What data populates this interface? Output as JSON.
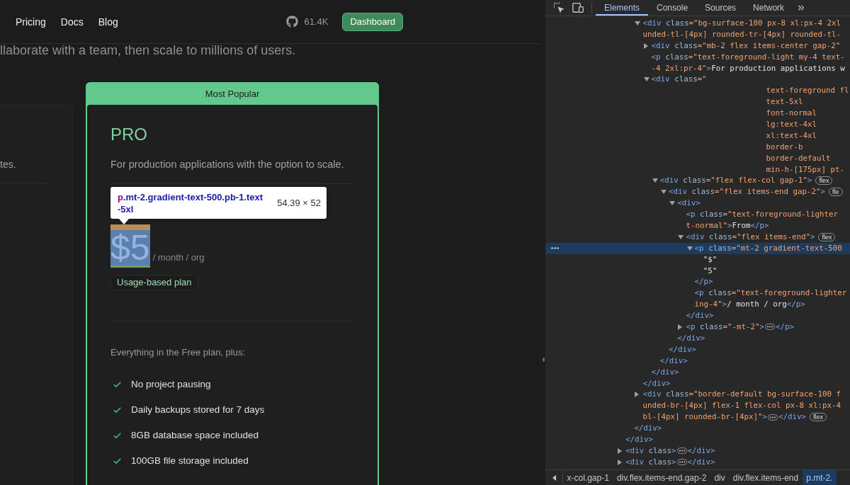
{
  "page": {
    "nav": {
      "links": [
        "Pricing",
        "Docs",
        "Blog"
      ],
      "github_stars": "61.4K",
      "dashboard_button": "Dashboard"
    },
    "subtitle": "llaborate with a team, then scale to millions of users.",
    "side_card": {
      "description": "tes."
    },
    "pro_card": {
      "ribbon": "Most Popular",
      "name": "PRO",
      "description": "For production applications with the option to scale.",
      "price": "$5",
      "price_highlighted": true,
      "period": "/ month / org",
      "badge": "Usage-based plan",
      "features_intro": "Everything in the Free plan, plus:",
      "features": [
        "No project pausing",
        "Daily backups stored for 7 days",
        "8GB database space included",
        "100GB file storage included"
      ]
    },
    "inspect_tooltip": {
      "tag": "p",
      "selector": ".mt-2.gradient-text-500.pb-1.text-5xl",
      "size": "54.39 × 52"
    }
  },
  "devtools": {
    "tabs": [
      {
        "label": "Elements",
        "selected": true
      },
      {
        "label": "Console",
        "selected": false
      },
      {
        "label": "Sources",
        "selected": false
      },
      {
        "label": "Network",
        "selected": false
      }
    ],
    "dom_tree": [
      {
        "selected": false,
        "children": [
          {
            "selected": false,
            "children": [
              {
                "expanded": true,
                "selected": false,
                "lines": [
                  [
                    {
                      "kind": "tag",
                      "text": "<div"
                    },
                    {
                      "kind": "attr",
                      "text": "class"
                    },
                    {
                      "kind": "value",
                      "text": "=\"bg-surface-100 px-8 xl:px-4 2xl"
                    }
                  ],
                  [
                    {
                      "kind": "value",
                      "text": "unded-tl-[4px] rounded-tr-[4px] rounded-tl-"
                    }
                  ]
                ],
                "children": [
                  {
                    "expanded": false,
                    "selected": false,
                    "lines": [
                      [
                        {
                          "kind": "tag",
                          "text": "<div"
                        },
                        {
                          "kind": "attr",
                          "text": "class"
                        },
                        {
                          "kind": "value",
                          "text": "=\"mb-2 flex items-center gap-2\""
                        }
                      ]
                    ]
                  },
                  {
                    "selected": false,
                    "lines": [
                      [
                        {
                          "kind": "tag",
                          "text": "<p"
                        },
                        {
                          "kind": "attr",
                          "text": "class"
                        },
                        {
                          "kind": "value",
                          "text": "=\"text-foreground-light my-4 text-"
                        }
                      ],
                      [
                        {
                          "kind": "value",
                          "text": "-4 2xl:pr-4\""
                        },
                        {
                          "kind": "tag",
                          "text": ">"
                        },
                        {
                          "kind": "text",
                          "text": "For production applications w"
                        }
                      ]
                    ]
                  },
                  {
                    "expanded": true,
                    "selected": false,
                    "lines": [
                      [
                        {
                          "kind": "tag",
                          "text": "<div"
                        },
                        {
                          "kind": "attr",
                          "text": "class"
                        },
                        {
                          "kind": "value",
                          "text": "=\""
                        }
                      ]
                    ],
                    "class_lines": [
                      "text-foreground fl",
                      "text-5xl",
                      "font-normal",
                      "lg:text-4xl",
                      "xl:text-4xl",
                      "border-b",
                      "border-default",
                      "min-h-[175px] pt-"
                    ],
                    "children": [
                      {
                        "expanded": true,
                        "selected": false,
                        "lines": [
                          [
                            {
                              "kind": "tag",
                              "text": "<div"
                            },
                            {
                              "kind": "attr",
                              "text": "class"
                            },
                            {
                              "kind": "value",
                              "text": "=\"flex flex-col gap-1\""
                            },
                            {
                              "kind": "tag",
                              "text": ">"
                            },
                            {
                              "kind": "badge",
                              "text": "flex"
                            }
                          ]
                        ],
                        "children": [
                          {
                            "expanded": true,
                            "selected": false,
                            "lines": [
                              [
                                {
                                  "kind": "tag",
                                  "text": "<div"
                                },
                                {
                                  "kind": "attr",
                                  "text": "class"
                                },
                                {
                                  "kind": "value",
                                  "text": "=\"flex items-end gap-2\""
                                },
                                {
                                  "kind": "tag",
                                  "text": ">"
                                },
                                {
                                  "kind": "badge",
                                  "text": "fle"
                                }
                              ]
                            ],
                            "children": [
                              {
                                "expanded": true,
                                "selected": false,
                                "lines": [
                                  [
                                    {
                                      "kind": "tag",
                                      "text": "<div>"
                                    }
                                  ]
                                ],
                                "children": [
                                  {
                                    "selected": false,
                                    "lines": [
                                      [
                                        {
                                          "kind": "tag",
                                          "text": "<p"
                                        },
                                        {
                                          "kind": "attr",
                                          "text": "class"
                                        },
                                        {
                                          "kind": "value",
                                          "text": "=\"text-foreground-lighter"
                                        }
                                      ],
                                      [
                                        {
                                          "kind": "value",
                                          "text": "t-normal\""
                                        },
                                        {
                                          "kind": "tag",
                                          "text": ">"
                                        },
                                        {
                                          "kind": "text",
                                          "text": "From"
                                        },
                                        {
                                          "kind": "tag",
                                          "text": "</p>"
                                        }
                                      ]
                                    ]
                                  },
                                  {
                                    "expanded": true,
                                    "selected": false,
                                    "lines": [
                                      [
                                        {
                                          "kind": "tag",
                                          "text": "<div"
                                        },
                                        {
                                          "kind": "attr",
                                          "text": "class"
                                        },
                                        {
                                          "kind": "value",
                                          "text": "=\"flex items-end\""
                                        },
                                        {
                                          "kind": "tag",
                                          "text": ">"
                                        },
                                        {
                                          "kind": "badge",
                                          "text": "flex"
                                        }
                                      ]
                                    ],
                                    "children": [
                                      {
                                        "expanded": true,
                                        "selected": true,
                                        "lines": [
                                          [
                                            {
                                              "kind": "tag",
                                              "text": "<p"
                                            },
                                            {
                                              "kind": "attr",
                                              "text": "class"
                                            },
                                            {
                                              "kind": "value",
                                              "text": "=\"mt-2 gradient-text-500"
                                            }
                                          ]
                                        ],
                                        "children": [
                                          {
                                            "selected": false,
                                            "lines": [
                                              [
                                                {
                                                  "kind": "text",
                                                  "text": "\"$\""
                                                }
                                              ]
                                            ]
                                          },
                                          {
                                            "selected": false,
                                            "lines": [
                                              [
                                                {
                                                  "kind": "text",
                                                  "text": "\"5\""
                                                }
                                              ]
                                            ]
                                          }
                                        ],
                                        "closing": "</p>"
                                      },
                                      {
                                        "selected": false,
                                        "lines": [
                                          [
                                            {
                                              "kind": "tag",
                                              "text": "<p"
                                            },
                                            {
                                              "kind": "attr",
                                              "text": "class"
                                            },
                                            {
                                              "kind": "value",
                                              "text": "=\"text-foreground-lighter"
                                            }
                                          ],
                                          [
                                            {
                                              "kind": "value",
                                              "text": "ing-4\""
                                            },
                                            {
                                              "kind": "tag",
                                              "text": ">"
                                            },
                                            {
                                              "kind": "text",
                                              "text": "/ month / org"
                                            },
                                            {
                                              "kind": "tag",
                                              "text": "</p>"
                                            }
                                          ]
                                        ]
                                      }
                                    ],
                                    "closing": "</div>"
                                  },
                                  {
                                    "expanded": false,
                                    "selected": false,
                                    "lines": [
                                      [
                                        {
                                          "kind": "tag",
                                          "text": "<p"
                                        },
                                        {
                                          "kind": "attr",
                                          "text": "class"
                                        },
                                        {
                                          "kind": "value",
                                          "text": "=\"-mt-2\""
                                        },
                                        {
                                          "kind": "tag",
                                          "text": ">"
                                        },
                                        {
                                          "kind": "ellipsis"
                                        },
                                        {
                                          "kind": "tag",
                                          "text": "</p>"
                                        }
                                      ]
                                    ]
                                  }
                                ],
                                "closing": "</div>"
                              }
                            ],
                            "closing": "</div>"
                          }
                        ],
                        "closing": "</div>"
                      }
                    ],
                    "closing": "</div>"
                  }
                ],
                "closing": "</div>"
              },
              {
                "expanded": false,
                "selected": false,
                "lines": [
                  [
                    {
                      "kind": "tag",
                      "text": "<div"
                    },
                    {
                      "kind": "attr",
                      "text": "class"
                    },
                    {
                      "kind": "value",
                      "text": "=\"border-default bg-surface-100 f"
                    }
                  ],
                  [
                    {
                      "kind": "value",
                      "text": "unded-br-[4px] flex-1 flex-col px-8 xl:px-4"
                    }
                  ],
                  [
                    {
                      "kind": "value",
                      "text": "bl-[4px] rounded-br-[4px]\""
                    },
                    {
                      "kind": "tag",
                      "text": ">"
                    },
                    {
                      "kind": "ellipsis"
                    },
                    {
                      "kind": "tag",
                      "text": "</div>"
                    },
                    {
                      "kind": "badge",
                      "text": "flex"
                    }
                  ]
                ]
              }
            ],
            "closing": "</div>"
          }
        ],
        "closing": "</div>"
      },
      {
        "expanded": false,
        "selected": false,
        "lines": [
          [
            {
              "kind": "tag",
              "text": "<div"
            },
            {
              "kind": "attr",
              "text": "class"
            },
            {
              "kind": "tag",
              "text": ">"
            },
            {
              "kind": "ellipsis"
            },
            {
              "kind": "tag",
              "text": "</div>"
            }
          ]
        ]
      },
      {
        "expanded": false,
        "selected": false,
        "lines": [
          [
            {
              "kind": "tag",
              "text": "<div"
            },
            {
              "kind": "attr",
              "text": "class"
            },
            {
              "kind": "tag",
              "text": ">"
            },
            {
              "kind": "ellipsis"
            },
            {
              "kind": "tag",
              "text": "</div>"
            }
          ]
        ]
      }
    ],
    "breadcrumbs": [
      {
        "label": "x-col.gap-1",
        "selected": false
      },
      {
        "label": "div.flex.items-end.gap-2",
        "selected": false
      },
      {
        "label": "div",
        "selected": false
      },
      {
        "label": "div.flex.items-end",
        "selected": false
      },
      {
        "label": "p.mt-2.",
        "selected": true
      }
    ]
  }
}
